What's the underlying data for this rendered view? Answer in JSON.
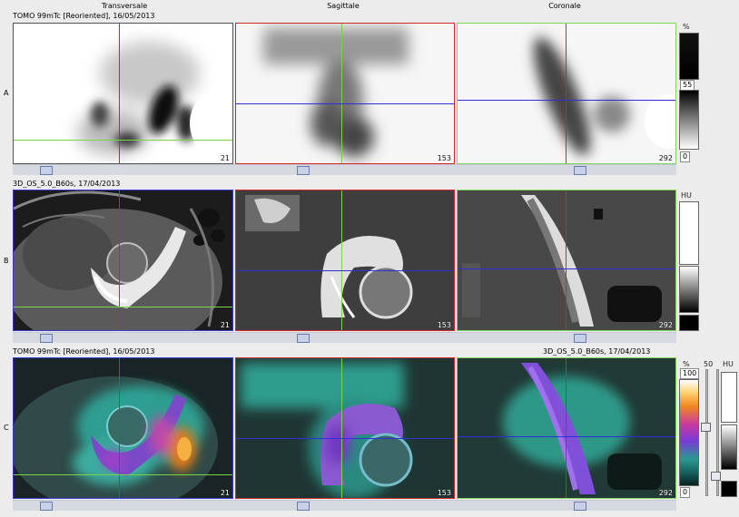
{
  "columns": {
    "transversal": "Transversale",
    "sagittal": "Sagittale",
    "coronal": "Coronale"
  },
  "rows": {
    "a": {
      "label": "A",
      "series": "TOMO 99mTc [Reoriented], 16/05/2013"
    },
    "b": {
      "label": "B",
      "series": "3D_OS_5.0_B60s, 17/04/2013"
    },
    "c": {
      "label": "C",
      "series_left": "TOMO 99mTc [Reoriented], 16/05/2013",
      "series_right": "3D_OS_5.0_B60s, 17/04/2013"
    }
  },
  "slices": {
    "transversal": "21",
    "sagittal": "153",
    "coronal": "292"
  },
  "colorbars": {
    "a": {
      "unit": "%",
      "value": "55",
      "min": "0"
    },
    "b": {
      "unit": "HU"
    },
    "c": {
      "unit_pct": "%",
      "max": "100",
      "min": "0",
      "fusion_value": "50",
      "unit_hu": "HU"
    }
  },
  "colors": {
    "crosshair_vertical": "#e02020",
    "crosshair_horizontal": "#3030d8",
    "crosshair_green": "#7ad24a",
    "selection_red": "#cc2a2a",
    "selection_green": "#7fd45a",
    "selection_blue": "#3a3ad0"
  }
}
